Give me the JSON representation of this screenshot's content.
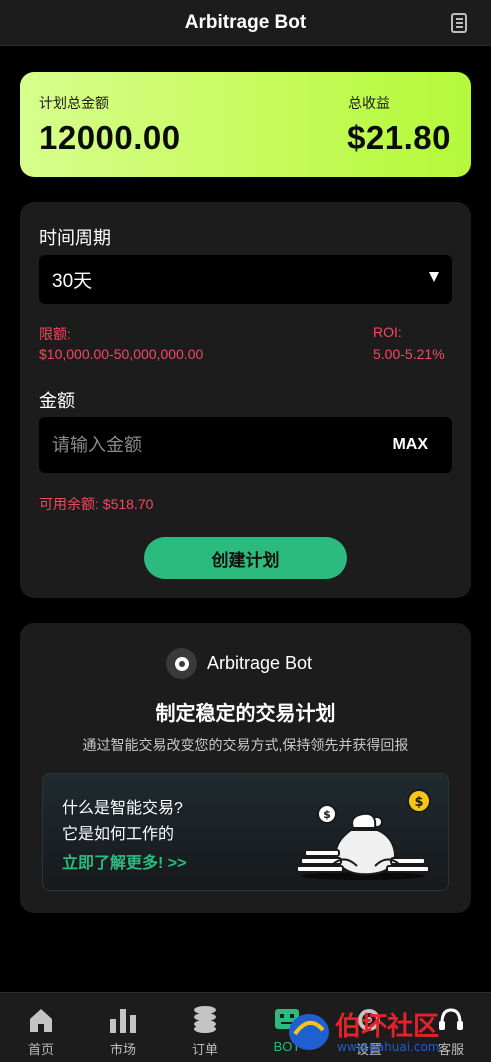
{
  "header": {
    "title": "Arbitrage Bot",
    "menu_icon": "document-list-icon"
  },
  "summary": {
    "total_plan_label": "计划总金额",
    "total_plan_value": "12000.00",
    "total_income_label": "总收益",
    "total_income_value": "$21.80"
  },
  "plan_form": {
    "period_label": "时间周期",
    "period_selected": "30天",
    "limit_label": "限额:",
    "limit_value": "$10,000.00-50,000,000.00",
    "roi_label": "ROI:",
    "roi_value": "5.00-5.21%",
    "amount_label": "金额",
    "amount_placeholder": "请输入金额",
    "max_label": "MAX",
    "available_label": "可用余额: $518.70",
    "create_button": "创建计划"
  },
  "info": {
    "bot_name": "Arbitrage Bot",
    "title": "制定稳定的交易计划",
    "subtitle": "通过智能交易改变您的交易方式,保持领先并获得回报",
    "question_1": "什么是智能交易?",
    "question_2": "它是如何工作的",
    "learn_more": "立即了解更多! >>"
  },
  "bottom_nav": {
    "items": [
      {
        "label": "首页",
        "icon": "home-icon"
      },
      {
        "label": "市场",
        "icon": "bar-chart-icon"
      },
      {
        "label": "订单",
        "icon": "coin-stack-icon"
      },
      {
        "label": "BOT",
        "icon": "bot-icon",
        "active": true
      },
      {
        "label": "设置",
        "icon": "settings-icon"
      },
      {
        "label": "客服",
        "icon": "headset-icon"
      }
    ]
  },
  "colors": {
    "accent_green": "#2cbb7e",
    "lime": "#c6fb5c",
    "alert_red": "#f5495f",
    "card_bg": "#1c1c1c"
  },
  "watermark": {
    "text": "伯坏社区",
    "url": "www.pahuai.com"
  }
}
